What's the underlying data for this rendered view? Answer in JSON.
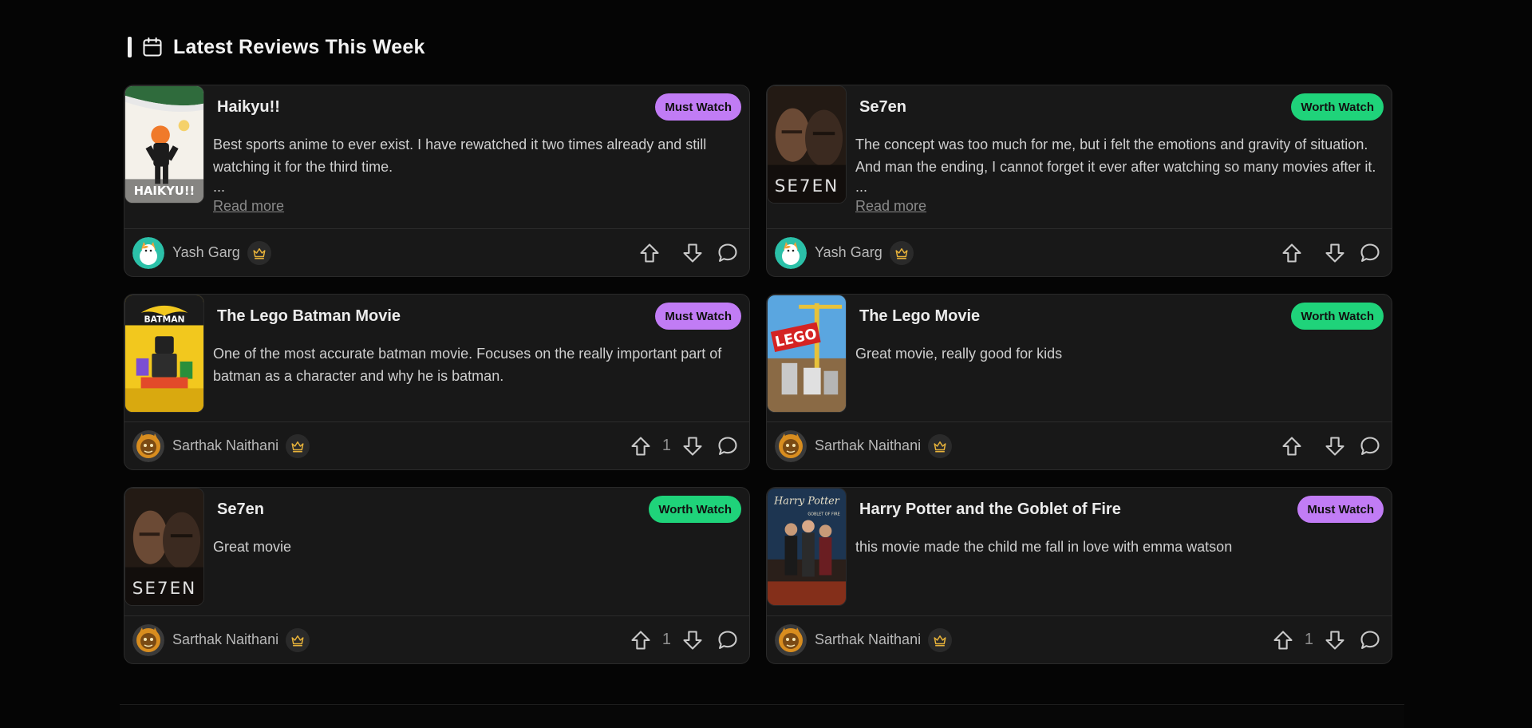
{
  "section": {
    "title": "Latest Reviews This Week"
  },
  "colors": {
    "must_watch": "#c17cf5",
    "worth_watch": "#1fd37a",
    "crown": "#e8b33a"
  },
  "reviews": [
    {
      "title": "Haikyu!!",
      "badge": "Must Watch",
      "text": "Best sports anime to ever exist. I have rewatched it two times already and still watching it for the third time.",
      "ellipsis": "...",
      "read_more": "Read more",
      "user": "Yash Garg",
      "votes": "",
      "poster": "haikyu-poster"
    },
    {
      "title": "Se7en",
      "badge": "Worth Watch",
      "text": "The concept was too much for me, but i felt the emotions and gravity of situation. And man the ending, I cannot forget it ever after watching so many movies after it.",
      "ellipsis": "...",
      "read_more": "Read more",
      "user": "Yash Garg",
      "votes": "",
      "poster": "se7en-poster"
    },
    {
      "title": "The Lego Batman Movie",
      "badge": "Must Watch",
      "text": "One of the most accurate batman movie. Focuses on the really important part of batman as a character and why he is batman.",
      "user": "Sarthak Naithani",
      "votes": "1",
      "poster": "lego-batman-poster"
    },
    {
      "title": "The Lego Movie",
      "badge": "Worth Watch",
      "text": "Great movie, really good for kids",
      "user": "Sarthak Naithani",
      "votes": "",
      "poster": "lego-movie-poster"
    },
    {
      "title": "Se7en",
      "badge": "Worth Watch",
      "text": "Great movie",
      "user": "Sarthak Naithani",
      "votes": "1",
      "poster": "se7en-poster"
    },
    {
      "title": "Harry Potter and the Goblet of Fire",
      "badge": "Must Watch",
      "text": "this movie made the child me fall in love with emma watson",
      "user": "Sarthak Naithani",
      "votes": "1",
      "poster": "harry-potter-poster"
    }
  ],
  "poster_text": {
    "haikyu": "HAIKYU!!",
    "se7en": "SE7EN",
    "lego_batman": "BATMAN",
    "lego_movie": "LEGO",
    "hp_line1": "Harry Potter",
    "hp_line2": "GOBLET OF FIRE"
  },
  "icons": {
    "header": "calendar-icon",
    "upvote": "arrow-up-icon",
    "downvote": "arrow-down-icon",
    "comment": "comment-bubble-icon",
    "badge": "crown-icon"
  }
}
